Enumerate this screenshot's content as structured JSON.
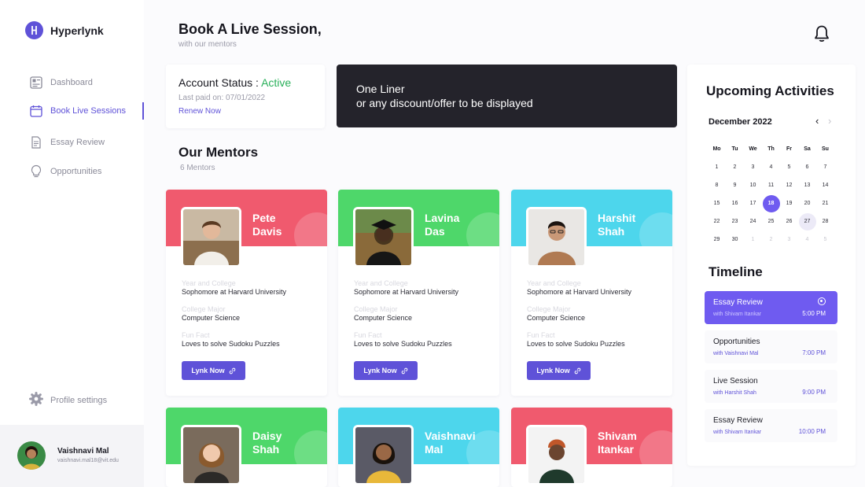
{
  "app": {
    "name": "Hyperlynk"
  },
  "sidebar": {
    "items": [
      {
        "label": "Dashboard",
        "icon": "dashboard-icon"
      },
      {
        "label": "Book Live Sessions",
        "icon": "calendar-icon"
      },
      {
        "label": "Essay Review",
        "icon": "document-icon"
      },
      {
        "label": "Opportunities",
        "icon": "lightbulb-icon"
      }
    ],
    "settings_label": "Profile settings",
    "user": {
      "name": "Vaishnavi Mal",
      "email": "vaishnavi.mal18@vit.edu"
    }
  },
  "header": {
    "title": "Book A Live Session,",
    "subtitle": "with our mentors"
  },
  "account": {
    "title": "Account Status : ",
    "status": "Active",
    "last_paid": "Last paid on: 07/01/2022",
    "renew": "Renew Now"
  },
  "banner": {
    "line1": "One Liner",
    "line2": "or any discount/offer to be displayed"
  },
  "mentors": {
    "title": "Our Mentors",
    "count": "6 Mentors",
    "field_labels": {
      "college": "Year and College",
      "major": "College Major",
      "fact": "Fun Fact"
    },
    "button_label": "Lynk Now",
    "cards": [
      {
        "first": "Pete",
        "last": "Davis",
        "college": "Sophomore at Harvard University",
        "major": "Computer Science",
        "fact": "Loves to solve Sudoku Puzzles",
        "color": "#f05a6e"
      },
      {
        "first": "Lavina",
        "last": "Das",
        "college": "Sophomore at Harvard University",
        "major": "Computer Science",
        "fact": "Loves to solve Sudoku Puzzles",
        "color": "#4ed76a"
      },
      {
        "first": "Harshit",
        "last": "Shah",
        "college": "Sophomore at Harvard University",
        "major": "Computer Science",
        "fact": "Loves to solve Sudoku Puzzles",
        "color": "#4dd6ec"
      },
      {
        "first": "Daisy",
        "last": "Shah",
        "color": "#4ed76a"
      },
      {
        "first": "Vaishnavi",
        "last": "Mal",
        "color": "#4dd6ec"
      },
      {
        "first": "Shivam",
        "last": "Itankar",
        "color": "#f05a6e"
      }
    ]
  },
  "activities": {
    "title": "Upcoming Activities",
    "month": "December 2022",
    "weekdays": [
      "Mo",
      "Tu",
      "We",
      "Th",
      "Fr",
      "Sa",
      "Su"
    ],
    "weeks": [
      [
        "1",
        "2",
        "3",
        "4",
        "5",
        "6",
        "7"
      ],
      [
        "8",
        "9",
        "10",
        "11",
        "12",
        "13",
        "14"
      ],
      [
        "15",
        "16",
        "17",
        "18",
        "19",
        "20",
        "21"
      ],
      [
        "22",
        "23",
        "24",
        "25",
        "26",
        "27",
        "28"
      ],
      [
        "29",
        "30",
        "1",
        "2",
        "3",
        "4",
        "5"
      ]
    ],
    "selected_day": "18",
    "marked_day": "27"
  },
  "timeline": {
    "title": "Timeline",
    "items": [
      {
        "name": "Essay Review",
        "with": "with Shivam Itankar",
        "time": "5:00 PM"
      },
      {
        "name": "Opportunities",
        "with": "with Vaishnavi Mal",
        "time": "7:00 PM"
      },
      {
        "name": "Live Session",
        "with": "with Harshit Shah",
        "time": "9:00 PM"
      },
      {
        "name": "Essay Review",
        "with": "with Shivam Itankar",
        "time": "10:00 PM"
      }
    ]
  }
}
